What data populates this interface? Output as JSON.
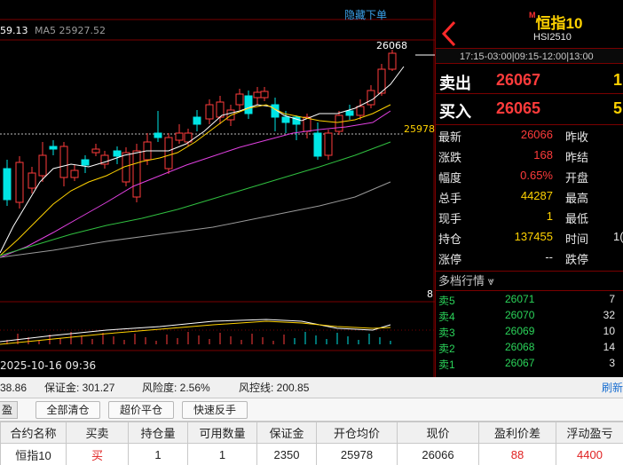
{
  "chart": {
    "hide_order_label": "隐藏下单",
    "ma_legend": [
      {
        "text": "59.13",
        "color": "#ffffff"
      },
      {
        "text": "MA5 25927.52",
        "color": "#9a9a9a"
      }
    ],
    "high_label": "26068",
    "line_price_label": "25978",
    "edge_label": "8",
    "last_date": "2025-10-16 09:36",
    "colors": {
      "up": "#ff3b3b",
      "down": "#00e5e5",
      "ma_white": "#ffffff",
      "ma_yellow": "#ffd200",
      "ma_magenta": "#e040e0",
      "ma_green": "#30c040",
      "ma_gray": "#9a9a9a"
    }
  },
  "quote": {
    "mark": "M",
    "title": "恒指10",
    "code": "HSI2510",
    "hours": "17:15-03:00|09:15-12:00|13:00",
    "ask_label": "卖出",
    "ask_price": "26067",
    "ask_vol": "1",
    "bid_label": "买入",
    "bid_price": "26065",
    "bid_vol": "5",
    "stats": [
      {
        "k1": "最新",
        "v1": "26066",
        "c1": "red",
        "k2": "昨收"
      },
      {
        "k1": "涨跌",
        "v1": "168",
        "c1": "red",
        "k2": "昨结"
      },
      {
        "k1": "幅度",
        "v1": "0.65%",
        "c1": "red",
        "k2": "开盘"
      },
      {
        "k1": "总手",
        "v1": "44287",
        "c1": "yellow",
        "k2": "最高"
      },
      {
        "k1": "现手",
        "v1": "1",
        "c1": "yellow",
        "k2": "最低"
      },
      {
        "k1": "持仓",
        "v1": "137455",
        "c1": "yellow",
        "k2": "时间",
        "v2": "1("
      },
      {
        "k1": "涨停",
        "v1": "--",
        "c1": "white",
        "k2": "跌停"
      }
    ],
    "depth_title": "多档行情 ⩔",
    "depth": [
      {
        "label": "卖5",
        "price": "26071",
        "vol": "7"
      },
      {
        "label": "卖4",
        "price": "26070",
        "vol": "32"
      },
      {
        "label": "卖3",
        "price": "26069",
        "vol": "10"
      },
      {
        "label": "卖2",
        "price": "26068",
        "vol": "14"
      },
      {
        "label": "卖1",
        "price": "26067",
        "vol": "3"
      }
    ]
  },
  "account": {
    "first_value": "38.86",
    "margin": "保证金: 301.27",
    "risk": "风险度: 2.56%",
    "risk_line": "风控线: 200.85",
    "refresh": "刷新"
  },
  "toolbar": {
    "tab": "盈",
    "close_all": "全部清仓",
    "over_close": "超价平仓",
    "quick_reverse": "快速反手"
  },
  "positions": {
    "headers": [
      "合约名称",
      "买卖",
      "持仓量",
      "可用数量",
      "保证金",
      "开仓均价",
      "现价",
      "盈利价差",
      "浮动盈亏"
    ],
    "rows": [
      [
        "恒指10",
        "买",
        "1",
        "1",
        "2350",
        "25978",
        "26066",
        "88",
        "4400"
      ]
    ]
  }
}
